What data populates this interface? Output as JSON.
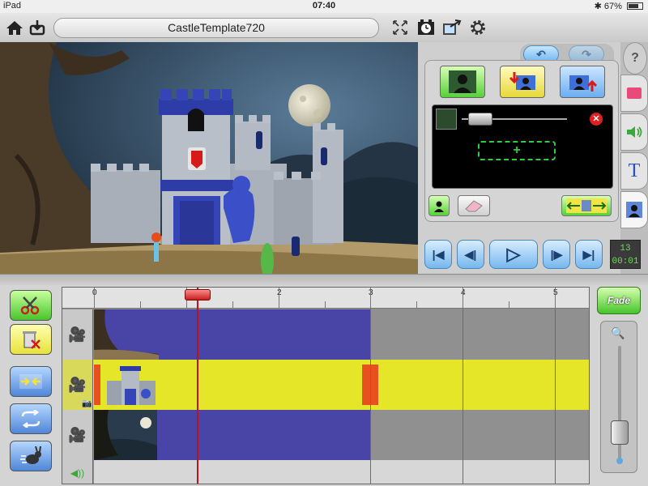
{
  "statusbar": {
    "device": "iPad",
    "time": "07:40",
    "battery": "67%"
  },
  "toolbar": {
    "title": "CastleTemplate720",
    "icons": [
      "home-icon",
      "import-icon",
      "fullscreen-icon",
      "timer-icon",
      "export-icon",
      "gear-icon"
    ]
  },
  "right_panel": {
    "tabs": [
      "image-tab",
      "audio-tab",
      "text-tab",
      "actor-tab"
    ],
    "text_tab_label": "T",
    "help_label": "?"
  },
  "counter": {
    "frame": "13",
    "time": "00:01"
  },
  "timeline": {
    "ticks": [
      "0",
      "1",
      "2",
      "3",
      "4",
      "5"
    ],
    "tracks": [
      {
        "name": "video-track-1",
        "clip_color": "#4845a6"
      },
      {
        "name": "video-track-2",
        "clip_color": "#e6e629",
        "selected": true
      },
      {
        "name": "video-track-3",
        "clip_color": "#4845a6"
      }
    ],
    "playhead_time": 1.12,
    "clip_end_time": 3
  },
  "fade_label": "Fade",
  "colors": {
    "accent_green": "#46c42a",
    "accent_yellow": "#e6e629",
    "clip_blue": "#4845a6",
    "playhead_red": "#c0121c"
  },
  "zoom": {
    "level": 0.3
  }
}
